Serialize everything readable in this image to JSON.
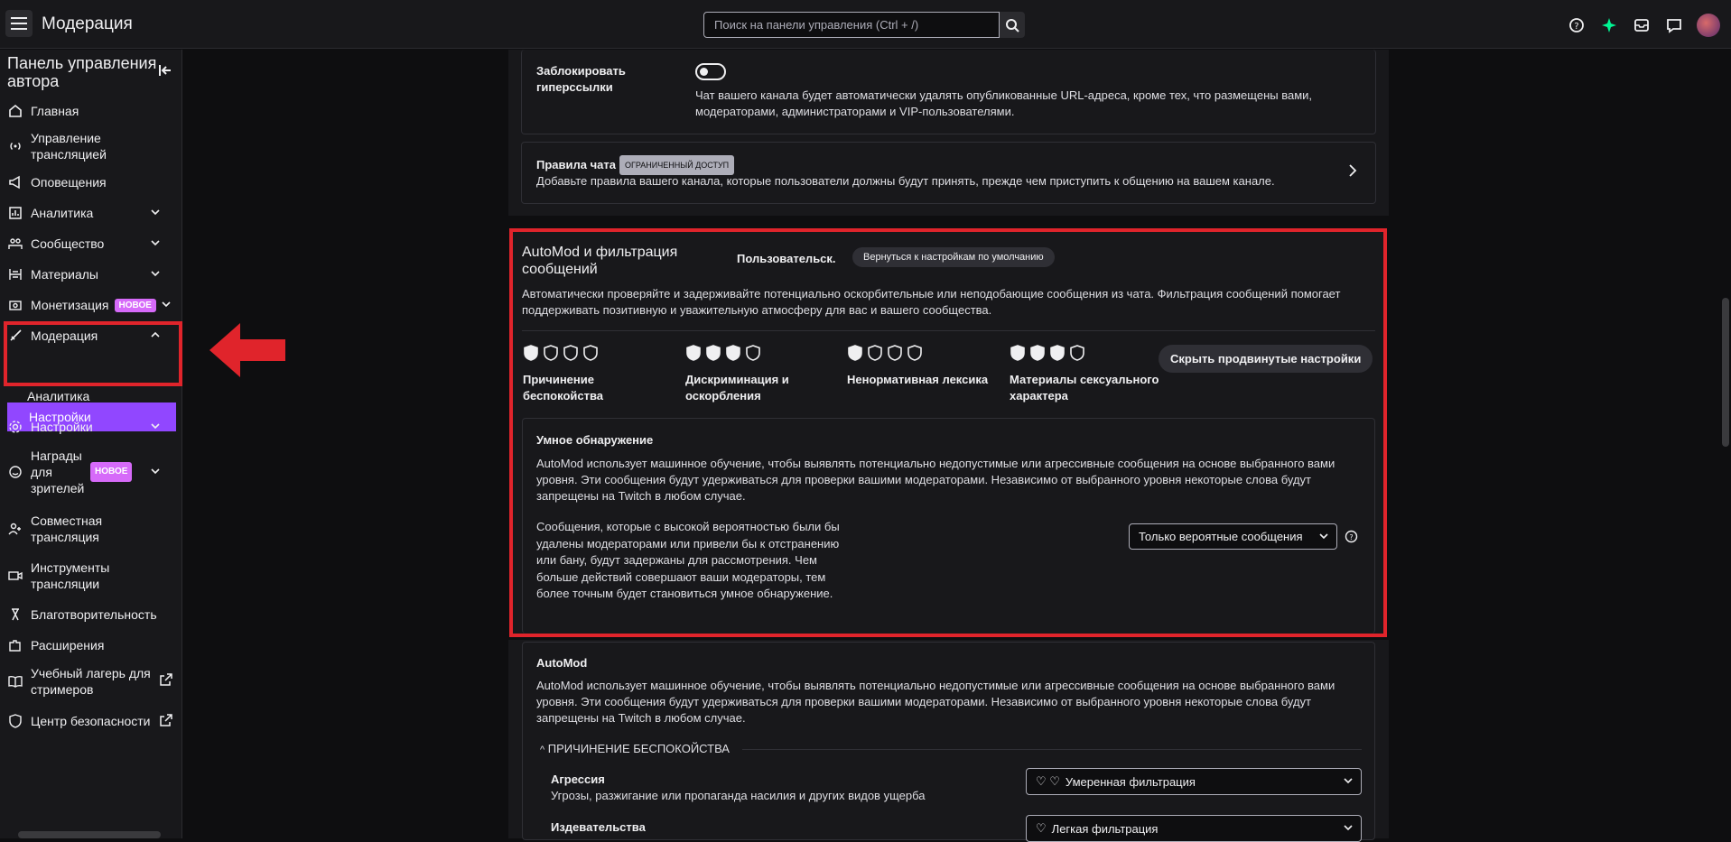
{
  "topbar": {
    "title": "Модерация",
    "search_placeholder": "Поиск на панели управления (Ctrl + /)"
  },
  "sidebar": {
    "title": "Панель управления автора",
    "items": [
      {
        "label": "Главная"
      },
      {
        "label": "Управление трансляцией"
      },
      {
        "label": "Оповещения"
      },
      {
        "label": "Аналитика"
      },
      {
        "label": "Сообщество"
      },
      {
        "label": "Материалы"
      },
      {
        "label": "Монетизация",
        "badge": "НОВОЕ"
      },
      {
        "label": "Модерация"
      },
      {
        "label": "Настройки"
      },
      {
        "label": "Аналитика"
      },
      {
        "label": "Настройки"
      },
      {
        "label": "Награды для зрителей",
        "badge": "НОВОЕ"
      },
      {
        "label": "Совместная трансляция"
      },
      {
        "label": "Инструменты трансляции"
      },
      {
        "label": "Благотворительность"
      },
      {
        "label": "Расширения"
      },
      {
        "label": "Учебный лагерь для стримеров"
      },
      {
        "label": "Центр безопасности"
      }
    ]
  },
  "block_links": {
    "title": "Заблокировать гиперссылки",
    "description": "Чат вашего канала будет автоматически удалять опубликованные URL-адреса, кроме тех, что размещены вами, модераторами, администраторами и VIP-пользователями."
  },
  "chat_rules": {
    "title": "Правила чата",
    "tag": "ОГРАНИЧЕННЫЙ ДОСТУП",
    "description": "Добавьте правила вашего канала, которые пользователи должны будут принять, прежде чем приступить к общению на вашем канале."
  },
  "automod": {
    "title": "AutoMod и фильтрация сообщений",
    "mode": "Пользовательск.",
    "reset_label": "Вернуться к настройкам по умолчанию",
    "description": "Автоматически проверяйте и задерживайте потенциально оскорбительные или неподобающие сообщения из чата. Фильтрация сообщений помогает поддерживать позитивную и уважительную атмосферу для вас и вашего сообщества.",
    "hide_advanced_label": "Скрыть продвинутые настройки",
    "categories": [
      {
        "label": "Причинение беспокойства",
        "level": 1
      },
      {
        "label": "Дискриминация и оскорбления",
        "level": 3
      },
      {
        "label": "Ненормативная лексика",
        "level": 1
      },
      {
        "label": "Материалы сексуального характера",
        "level": 3
      }
    ],
    "smart": {
      "title": "Умное обнаружение",
      "description": "AutoMod использует машинное обучение, чтобы выявлять потенциально недопустимые или агрессивные сообщения на основе выбранного вами уровня. Эти сообщения будут удерживаться для проверки вашими модераторами. Независимо от выбранного уровня некоторые слова будут запрещены на Twitch в любом случае.",
      "detail": "Сообщения, которые с высокой вероятностью были бы удалены модераторами или привели бы к отстранению или бану, будут задержаны для рассмотрения. Чем больше действий совершают ваши модераторы, тем более точным будет становиться умное обнаружение.",
      "select_value": "Только вероятные сообщения"
    }
  },
  "automod2": {
    "title": "AutoMod",
    "description": "AutoMod использует машинное обучение, чтобы выявлять потенциально недопустимые или агрессивные сообщения на основе выбранного вами уровня. Эти сообщения будут удерживаться для проверки вашими модераторами. Независимо от выбранного уровня некоторые слова будут запрещены на Twitch в любом случае.",
    "group_label": "ПРИЧИНЕНИЕ БЕСПОКОЙСТВА",
    "rows": [
      {
        "title": "Агрессия",
        "description": "Угрозы, разжигание или пропаганда насилия и других видов ущерба",
        "select": "Умеренная фильтрация"
      },
      {
        "title": "Издевательства",
        "description": "",
        "select": "Легкая фильтрация"
      }
    ]
  },
  "colors": {
    "accent": "#9147ff",
    "highlight": "#e0242b",
    "badge": "#d66af9"
  }
}
